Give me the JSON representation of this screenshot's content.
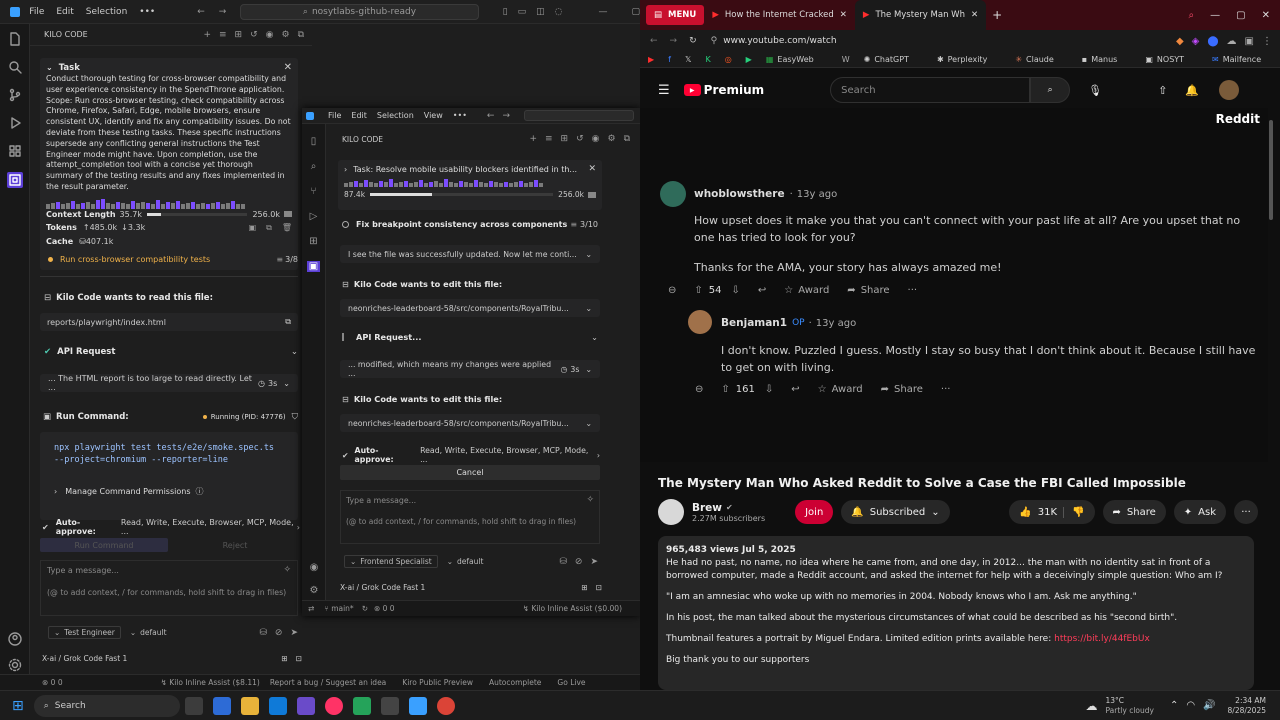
{
  "editor_left": {
    "menu": [
      "File",
      "Edit",
      "Selection"
    ],
    "search": "nosytlabs-github-ready",
    "panel_title": "KILO CODE",
    "task_label": "Task",
    "task_text": "Conduct thorough testing for cross-browser compatibility and user experience consistency in the SpendThrone application. Scope: Run cross-browser testing, check compatibility across Chrome, Firefox, Safari, Edge, mobile browsers, ensure consistent UX, identify and fix any compatibility issues. Do not deviate from these testing tasks. These specific instructions supersede any conflicting general instructions the Test Engineer mode might have. Upon completion, use the attempt_completion tool with a concise yet thorough summary of the testing results and any fixes implemented in the result parameter.",
    "context_label": "Context Length",
    "context_value": "35.7k",
    "context_max": "256.0k",
    "tokens_label": "Tokens",
    "tokens_up": "485.0k",
    "tokens_down": "3.3k",
    "cache_label": "Cache",
    "cache_value": "407.1k",
    "todo_text": "Run cross-browser compatibility tests",
    "todo_count": "3/8",
    "read_title": "Kilo Code wants to read this file:",
    "read_file": "reports/playwright/index.html",
    "api_title": "API Request",
    "api_text": "... The HTML report is too large to read directly. Let ...",
    "api_time": "3s",
    "run_title": "Run Command:",
    "running": "Running (PID: 47776)",
    "command": "npx playwright test tests/e2e/smoke.spec.ts --project=chromium --reporter=line",
    "manage_perm": "Manage Command Permissions",
    "auto_approve": "Auto-approve:",
    "auto_list": "Read, Write, Execute, Browser, MCP, Mode, ...",
    "run_btn": "Run Command",
    "reject_btn": "Reject",
    "msg_placeholder": "Type a message...",
    "msg_hint": "(@ to add context, / for commands, hold shift to drag in files)",
    "mode": "Test Engineer",
    "profile": "default",
    "model": "X-ai / Grok Code Fast 1",
    "status_left": "0  0",
    "status_items": [
      "Report a bug / Suggest an idea",
      "Kiro Public Preview",
      "Autocomplete",
      "Go Live"
    ],
    "kilo_assist": "Kilo Inline Assist ($8.11)"
  },
  "editor_right": {
    "menu": [
      "File",
      "Edit",
      "Selection",
      "View"
    ],
    "panel_title": "KILO CODE",
    "task_text": "Task: Resolve mobile usability blockers identified in th...",
    "context_value": "87.4k",
    "context_max": "256.0k",
    "todo_text": "Fix breakpoint consistency across components",
    "todo_count": "3/10",
    "row1": "I see the file was successfully updated. Now let me conti...",
    "edit_title": "Kilo Code wants to edit this file:",
    "edit_file": "neonriches-leaderboard-58/src/components/RoyalTribu...",
    "api_title": "API Request...",
    "api_text": "... modified, which means my changes were applied ...",
    "api_time": "3s",
    "auto_approve": "Auto-approve:",
    "auto_list": "Read, Write, Execute, Browser, MCP, Mode, ...",
    "cancel": "Cancel",
    "msg_placeholder": "Type a message...",
    "msg_hint": "(@ to add context, / for commands, hold shift to drag in files)",
    "mode": "Frontend Specialist",
    "profile": "default",
    "model": "X-ai / Grok Code Fast 1",
    "branch": "main*",
    "status_counts": "0  0",
    "kilo_assist": "Kilo Inline Assist ($0.00)"
  },
  "browser": {
    "tabs": [
      "MENU",
      "How the Internet Cracked",
      "The Mystery Man Wh"
    ],
    "url": "www.youtube.com/watch",
    "bookmarks": [
      "EasyWeb",
      "ChatGPT",
      "Perplexity",
      "Claude",
      "Manus",
      "NOSYT",
      "Mailfence"
    ],
    "search_placeholder": "Search",
    "brand": "Premium",
    "reddit_label": "Reddit",
    "comments": [
      {
        "user": "whoblowsthere",
        "time": "13y ago",
        "text1": "How upset does it make you that you can't connect with your past life at all? Are you upset that no one has tried to look for you?",
        "text2": "Thanks for the AMA, your story has always amazed me!",
        "votes": "54"
      },
      {
        "user": "Benjaman1",
        "op": "OP",
        "time": "13y ago",
        "text1": "I don't know. Puzzled I guess. Mostly I stay so busy that I don't think about it. Because I still have to get on with living.",
        "votes": "161"
      }
    ],
    "award": "Award",
    "share": "Share",
    "video_title": "The Mystery Man Who Asked Reddit to Solve a Case the FBI Called Impossible",
    "channel": "Brew",
    "subs": "2.27M subscribers",
    "join": "Join",
    "subscribed": "Subscribed",
    "likes": "31K",
    "share_btn": "Share",
    "ask": "Ask",
    "views": "965,483 views  Jul 5, 2025",
    "desc1": "He had no past, no name, no idea where he came from, and one day, in 2012... the man with no identity sat in front of a borrowed computer, made a Reddit account, and asked the internet for help with a deceivingly simple question: Who am I?",
    "desc2": "\"I am an amnesiac who woke up with no memories in 2004. Nobody knows who I am. Ask me anything.\"",
    "desc3": "In his post, the man talked about the mysterious circumstances of what could be described as his \"second birth\".",
    "desc4": "Thumbnail features a portrait by Miguel Endara. Limited edition prints available here:",
    "desc4_link": "https://bit.ly/44fEbUx",
    "desc5": "Big thank you to our supporters"
  },
  "taskbar": {
    "search": "Search",
    "weather_temp": "13°C",
    "weather_desc": "Partly cloudy",
    "time": "2:34 AM",
    "date": "8/28/2025"
  }
}
